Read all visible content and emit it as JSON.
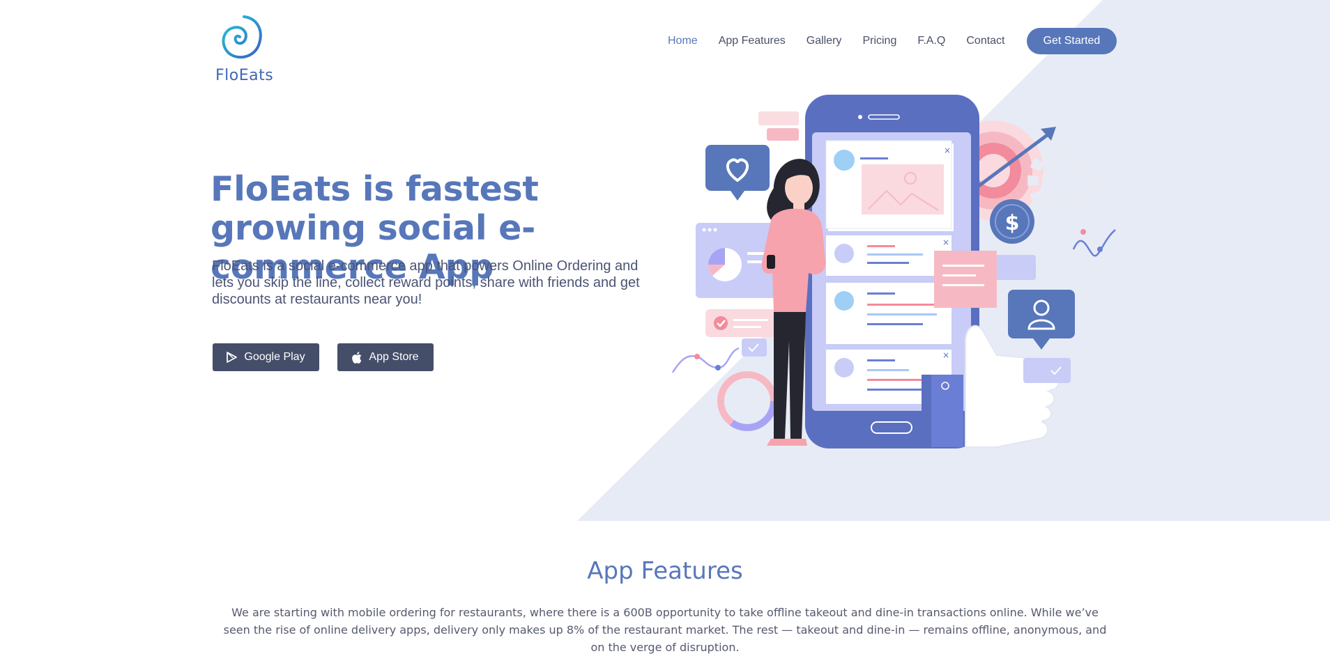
{
  "brand": {
    "name": "FloEats"
  },
  "nav": {
    "items": [
      "Home",
      "App Features",
      "Gallery",
      "Pricing",
      "F.A.Q",
      "Contact"
    ],
    "cta": "Get Started"
  },
  "hero": {
    "title": "FloEats is fastest growing social e-commerce App",
    "text": "FloEats is a social e-commerce app that powers Online Ordering and lets you skip the line, collect reward points, share with friends and get discounts at restaurants near you!",
    "buttons": {
      "google_play": "Google Play",
      "app_store": "App Store"
    },
    "illustration_icons": [
      "phone-icon",
      "heart-icon",
      "dollar-icon",
      "user-icon",
      "thumbs-up-icon",
      "gear-icon",
      "target-icon"
    ]
  },
  "features": {
    "title": "App Features",
    "text": "We are starting with mobile ordering for restaurants, where there is a 600B opportunity to take offline takeout and dine-in transactions online. While we’ve seen the rise of online delivery apps, delivery only makes up 8% of the restaurant market. The rest — takeout and dine-in — remains offline, anonymous, and on the verge of disruption."
  },
  "colors": {
    "primary": "#5777ba",
    "dark_button": "#454e69",
    "hero_bg": "#e7ebf5",
    "text": "#4b5474"
  }
}
